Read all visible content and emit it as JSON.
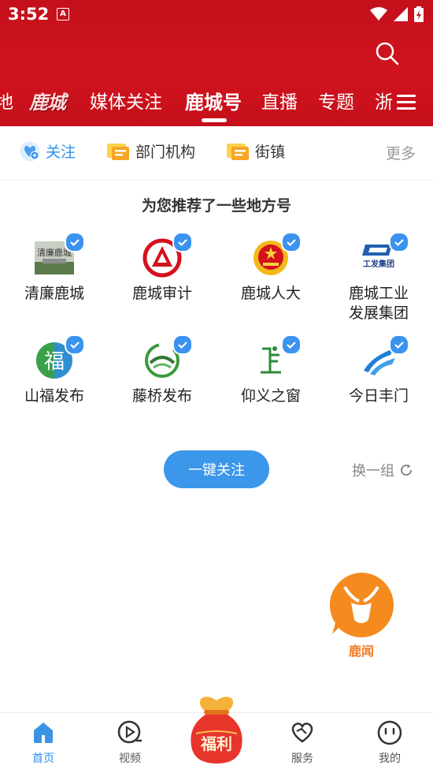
{
  "status": {
    "time": "3:52",
    "badge": "A"
  },
  "tabs": [
    {
      "label": "地"
    },
    {
      "label": "鹿城"
    },
    {
      "label": "媒体关注"
    },
    {
      "label": "鹿城号"
    },
    {
      "label": "直播"
    },
    {
      "label": "专题"
    },
    {
      "label": "浙"
    }
  ],
  "subnav": {
    "follow": "关注",
    "departments": "部门机构",
    "streets": "街镇",
    "more": "更多"
  },
  "recommend": {
    "title": "为您推荐了一些地方号",
    "accounts": [
      {
        "name": "清廉鹿城",
        "logo_text": "清廉鹿城"
      },
      {
        "name": "鹿城审计"
      },
      {
        "name": "鹿城人大"
      },
      {
        "name": "鹿城工业发展集团",
        "logo_text": "工发集团"
      },
      {
        "name": "山福发布",
        "logo_text": "福"
      },
      {
        "name": "藤桥发布"
      },
      {
        "name": "仰义之窗"
      },
      {
        "name": "今日丰门"
      }
    ],
    "follow_all": "一键关注",
    "refresh": "换一组"
  },
  "luwen": {
    "label": "鹿闻"
  },
  "bottom_nav": {
    "home": "首页",
    "video": "视频",
    "fuli": "福利",
    "service": "服务",
    "mine": "我的"
  },
  "colors": {
    "header_red": "#c4101b",
    "accent_blue": "#2d8ff0",
    "orange": "#f27a22"
  }
}
